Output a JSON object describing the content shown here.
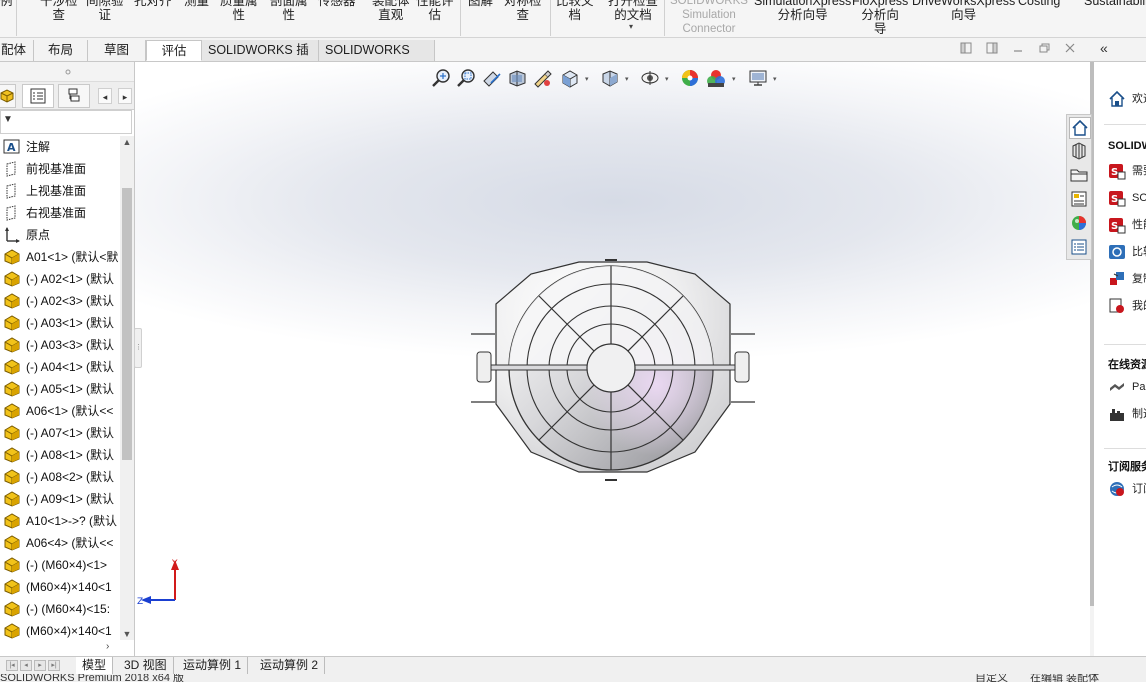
{
  "ribbon": {
    "items": [
      {
        "label": "例"
      },
      {
        "label": "干涉检\n查"
      },
      {
        "label": "间隙验\n证"
      },
      {
        "label": "孔对齐"
      },
      {
        "label": "测量"
      },
      {
        "label": "质量属\n性"
      },
      {
        "label": "剖面属\n性"
      },
      {
        "label": "传感器"
      },
      {
        "label": "装配体\n直观"
      },
      {
        "label": "性能评\n估"
      },
      {
        "label": "图解"
      },
      {
        "label": "对称检\n查"
      },
      {
        "label": "比较文\n档"
      },
      {
        "label": "打开检查\n的文档"
      },
      {
        "label": "SOLIDWORKS\nSimulation\nConnector"
      },
      {
        "label": "SimulationXpress\n分析向导"
      },
      {
        "label": "FloXpress\n分析向\n导"
      },
      {
        "label": "DriveWorksXpress\n向导"
      },
      {
        "label": "Costing"
      },
      {
        "label": "Sustainability"
      }
    ]
  },
  "command_tabs": {
    "items": [
      "配体",
      "布局",
      "草图",
      "评估",
      "SOLIDWORKS 插件",
      "SOLIDWORKS MBD"
    ],
    "active_index": 3
  },
  "feature_tree": {
    "filter_text": "▼",
    "items": [
      {
        "label": "注解",
        "icon": "annotation-icon"
      },
      {
        "label": "前视基准面",
        "icon": "plane-icon"
      },
      {
        "label": "上视基准面",
        "icon": "plane-icon"
      },
      {
        "label": "右视基准面",
        "icon": "plane-icon"
      },
      {
        "label": "原点",
        "icon": "origin-icon"
      },
      {
        "label": "A01<1> (默认<默",
        "icon": "part-icon"
      },
      {
        "label": "(-) A02<1> (默认",
        "icon": "part-icon"
      },
      {
        "label": "(-) A02<3> (默认",
        "icon": "part-icon"
      },
      {
        "label": "(-) A03<1> (默认",
        "icon": "part-icon"
      },
      {
        "label": "(-) A03<3> (默认",
        "icon": "part-icon"
      },
      {
        "label": "(-) A04<1> (默认",
        "icon": "part-icon"
      },
      {
        "label": "(-) A05<1> (默认",
        "icon": "part-icon"
      },
      {
        "label": "A06<1> (默认<<",
        "icon": "part-icon"
      },
      {
        "label": "(-) A07<1> (默认",
        "icon": "part-icon"
      },
      {
        "label": "(-) A08<1> (默认",
        "icon": "part-icon"
      },
      {
        "label": "(-) A08<2> (默认",
        "icon": "part-icon"
      },
      {
        "label": "(-) A09<1> (默认",
        "icon": "part-icon"
      },
      {
        "label": "A10<1>->? (默认",
        "icon": "part-icon"
      },
      {
        "label": "A06<4> (默认<<",
        "icon": "part-icon"
      },
      {
        "label": "(-) (M60×4)<1>",
        "icon": "part-icon"
      },
      {
        "label": "(M60×4)×140<1",
        "icon": "part-icon"
      },
      {
        "label": "(-) (M60×4)<15:",
        "icon": "part-icon"
      },
      {
        "label": "(M60×4)×140<1",
        "icon": "part-icon"
      }
    ]
  },
  "task_pane": {
    "home_label": "欢迎",
    "section1": "SOLIDWO",
    "section1_items": [
      "需要",
      "SOL",
      "性能",
      "比较",
      "复制",
      "我的"
    ],
    "section2": "在线资源",
    "section2_items": [
      "Par",
      "制造"
    ],
    "section3": "订阅服务",
    "section3_items": [
      "订阅"
    ]
  },
  "bottom_tabs": {
    "items": [
      "模型",
      "3D 视图",
      "运动算例 1",
      "运动算例 2"
    ],
    "active_index": 0
  },
  "status_bar": {
    "left": "SOLIDWORKS Premium 2018 x64 版",
    "mid": "自定义",
    "right": "在编辑 装配体"
  },
  "colors": {
    "accent": "#0b5cad",
    "axis_y": "#d11a1a",
    "axis_z": "#1a3fd1",
    "part_yellow": "#e8b400"
  }
}
